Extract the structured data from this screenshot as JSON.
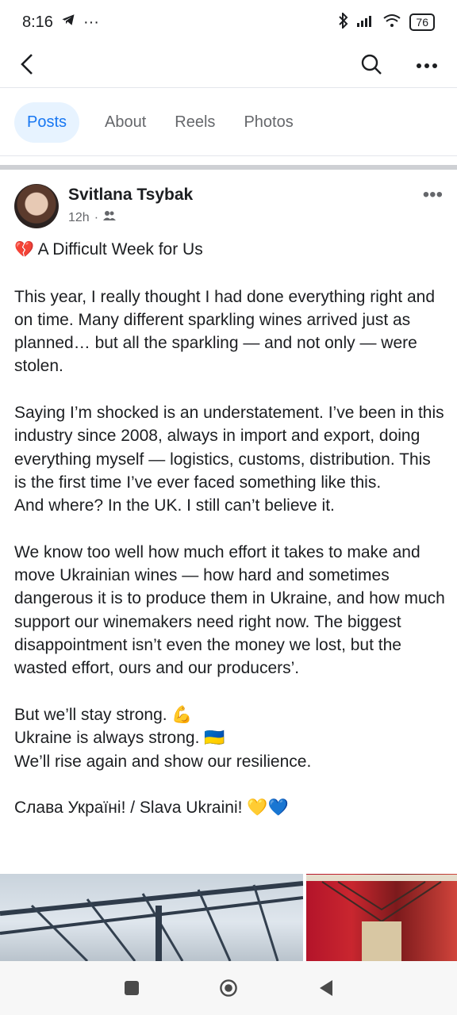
{
  "status": {
    "time": "8:16",
    "left_icons": [
      "telegram-icon",
      "more-dots-icon"
    ],
    "right_icons": [
      "bluetooth-icon",
      "signal-icon",
      "wifi-icon"
    ],
    "battery": "76"
  },
  "top_nav": {
    "icons": [
      "back-arrow-icon",
      "search-icon",
      "more-horizontal-icon"
    ]
  },
  "tabs": [
    {
      "label": "Posts",
      "active": true
    },
    {
      "label": "About",
      "active": false
    },
    {
      "label": "Reels",
      "active": false
    },
    {
      "label": "Photos",
      "active": false
    }
  ],
  "post": {
    "author": "Svitlana Tsybak",
    "time": "12h",
    "audience_icon": "friends-icon",
    "title_line": "A Difficult Week for Us",
    "paragraphs": [
      "This year, I really thought I had done everything right and on time. Many different sparkling wines arrived just as planned… but all the sparkling — and not only — were stolen.",
      "Saying I’m shocked is an understatement. I’ve been in this industry since 2008, always in import and export, doing everything myself — logistics, customs, distribution. This is the first time I’ve ever faced something like this.\nAnd where? In the UK. I still can’t believe it.",
      "We know too well how much effort it takes to make and move Ukrainian wines — how hard and sometimes dangerous it is to produce them in Ukraine, and how much support our winemakers need right now. The biggest disappointment isn’t even the money we lost, but the wasted effort, ours and our producers’."
    ],
    "closing_lines": [
      "But we’ll stay strong. 💪",
      "Ukraine is always strong. 🇺🇦",
      "We’ll rise again and show our resilience."
    ],
    "slava": "Слава Україні! / Slava Ukraini! 💛💙"
  },
  "bottom_nav": {
    "icons": [
      "square-nav-icon",
      "home-circle-icon",
      "back-triangle-icon"
    ]
  }
}
